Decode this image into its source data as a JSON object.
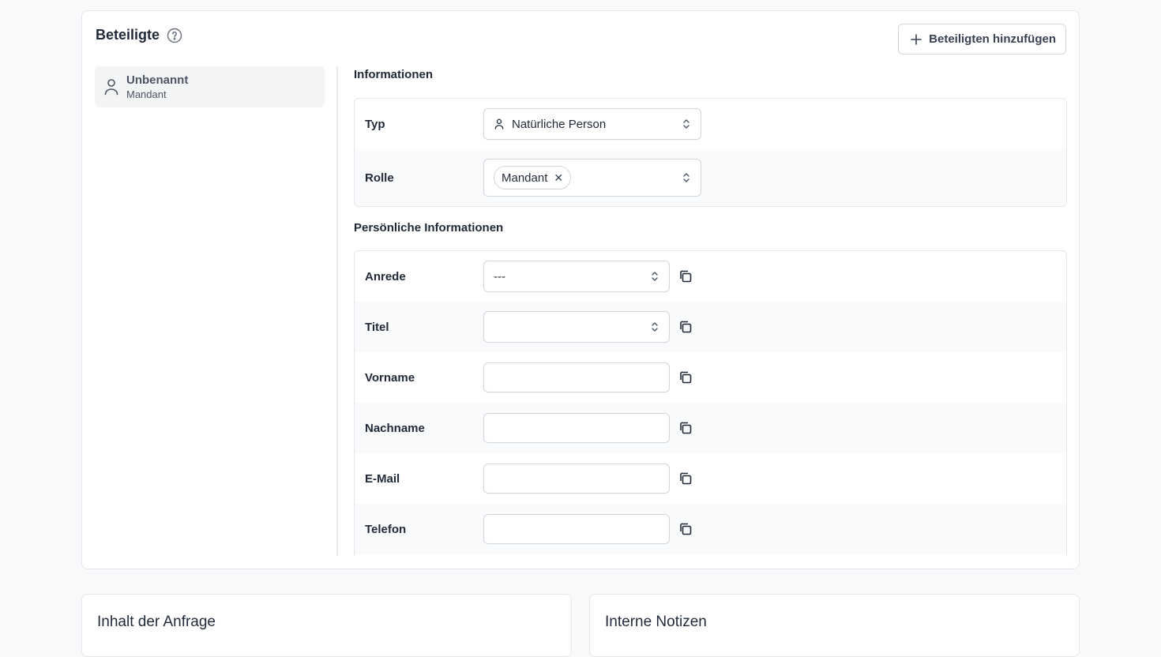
{
  "participants": {
    "title": "Beteiligte",
    "add_button": "Beteiligten hinzufügen",
    "list": [
      {
        "name": "Unbenannt",
        "role": "Mandant"
      }
    ]
  },
  "info": {
    "heading": "Informationen",
    "type_label": "Typ",
    "type_value": "Natürliche Person",
    "role_label": "Rolle",
    "role_chip": "Mandant"
  },
  "personal": {
    "heading": "Persönliche Informationen",
    "salutation_label": "Anrede",
    "salutation_value": "---",
    "title_label": "Titel",
    "title_value": "",
    "firstname_label": "Vorname",
    "lastname_label": "Nachname",
    "email_label": "E-Mail",
    "phone_label": "Telefon"
  },
  "bottom": {
    "request_content": "Inhalt der Anfrage",
    "internal_notes": "Interne Notizen"
  }
}
